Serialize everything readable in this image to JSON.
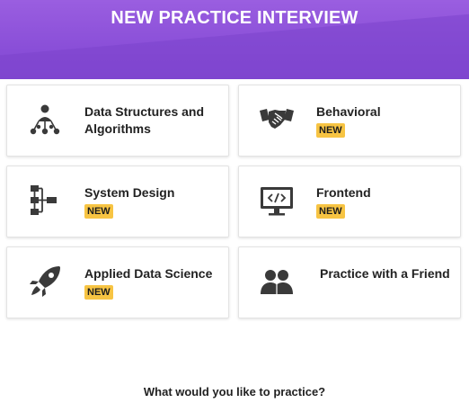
{
  "header": {
    "title": "NEW PRACTICE INTERVIEW"
  },
  "cards": [
    {
      "title": "Data Structures and Algorithms",
      "badge": "",
      "icon": "tree-graph-icon"
    },
    {
      "title": "Behavioral",
      "badge": "NEW",
      "icon": "handshake-icon"
    },
    {
      "title": "System Design",
      "badge": "NEW",
      "icon": "system-diagram-icon"
    },
    {
      "title": "Frontend",
      "badge": "NEW",
      "icon": "code-monitor-icon"
    },
    {
      "title": "Applied Data Science",
      "badge": "NEW",
      "icon": "rocket-icon"
    },
    {
      "title": "Practice with a Friend",
      "badge": "",
      "icon": "two-people-icon"
    }
  ],
  "footer": {
    "question": "What would you like to practice?"
  },
  "colors": {
    "header": "#8a4fd8",
    "badge": "#f7c443",
    "icon": "#3a3a3a"
  }
}
